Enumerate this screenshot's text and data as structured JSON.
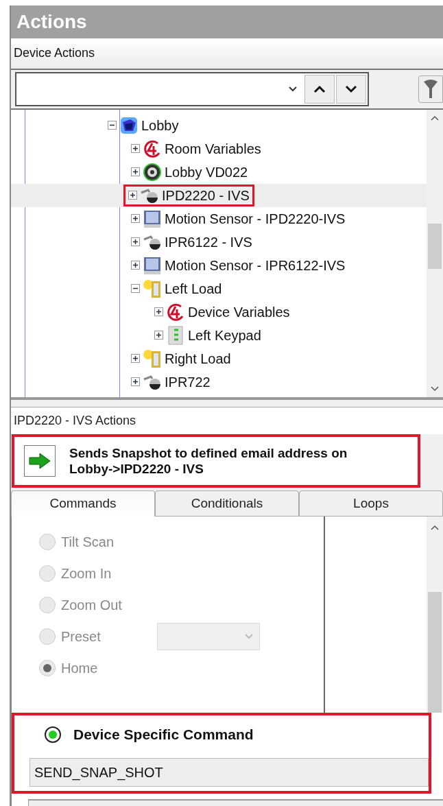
{
  "panel": {
    "title": "Actions"
  },
  "device_actions": {
    "label": "Device Actions"
  },
  "tree": [
    {
      "label": "Lobby",
      "kind": "room",
      "expanded": true,
      "selected": false,
      "callout": false,
      "children": [
        {
          "label": "Room Variables",
          "kind": "variables",
          "expanded": false,
          "selected": false,
          "callout": false
        },
        {
          "label": "Lobby VD022",
          "kind": "speaker",
          "expanded": false,
          "selected": false,
          "callout": false
        },
        {
          "label": "IPD2220 - IVS",
          "kind": "camera",
          "expanded": false,
          "selected": true,
          "callout": true
        },
        {
          "label": "Motion Sensor - IPD2220-IVS",
          "kind": "monitor",
          "expanded": false,
          "selected": false,
          "callout": false
        },
        {
          "label": "IPR6122 - IVS",
          "kind": "camera",
          "expanded": false,
          "selected": false,
          "callout": false
        },
        {
          "label": "Motion Sensor - IPR6122-IVS",
          "kind": "monitor",
          "expanded": false,
          "selected": false,
          "callout": false
        },
        {
          "label": "Left Load",
          "kind": "load",
          "expanded": true,
          "selected": false,
          "callout": false,
          "children": [
            {
              "label": "Device Variables",
              "kind": "variables",
              "expanded": false,
              "selected": false,
              "callout": false
            },
            {
              "label": "Left Keypad",
              "kind": "keypad",
              "expanded": false,
              "selected": false,
              "callout": false
            }
          ]
        },
        {
          "label": "Right Load",
          "kind": "load",
          "expanded": false,
          "selected": false,
          "callout": false
        },
        {
          "label": "IPR722",
          "kind": "camera",
          "expanded": false,
          "selected": false,
          "callout": false
        }
      ]
    }
  ],
  "actions": {
    "label": "IPD2220 - IVS Actions",
    "description": "Sends Snapshot to defined email address on\nLobby->IPD2220 - IVS",
    "callout": true
  },
  "tabs": [
    {
      "label": "Commands",
      "selected": true
    },
    {
      "label": "Conditionals",
      "selected": false
    },
    {
      "label": "Loops",
      "selected": false
    }
  ],
  "commands": [
    {
      "label": "Tilt Scan",
      "selected": false,
      "kind": "radio"
    },
    {
      "label": "Zoom In",
      "selected": false,
      "kind": "radio"
    },
    {
      "label": "Zoom Out",
      "selected": false,
      "kind": "radio"
    },
    {
      "label": "Preset",
      "selected": false,
      "kind": "radio-dropdown"
    },
    {
      "label": "Home",
      "selected": true,
      "kind": "radio"
    }
  ],
  "device_specific": {
    "label": "Device Specific Command",
    "selected": true,
    "value": "SEND_SNAP_SHOT",
    "callout": true
  }
}
